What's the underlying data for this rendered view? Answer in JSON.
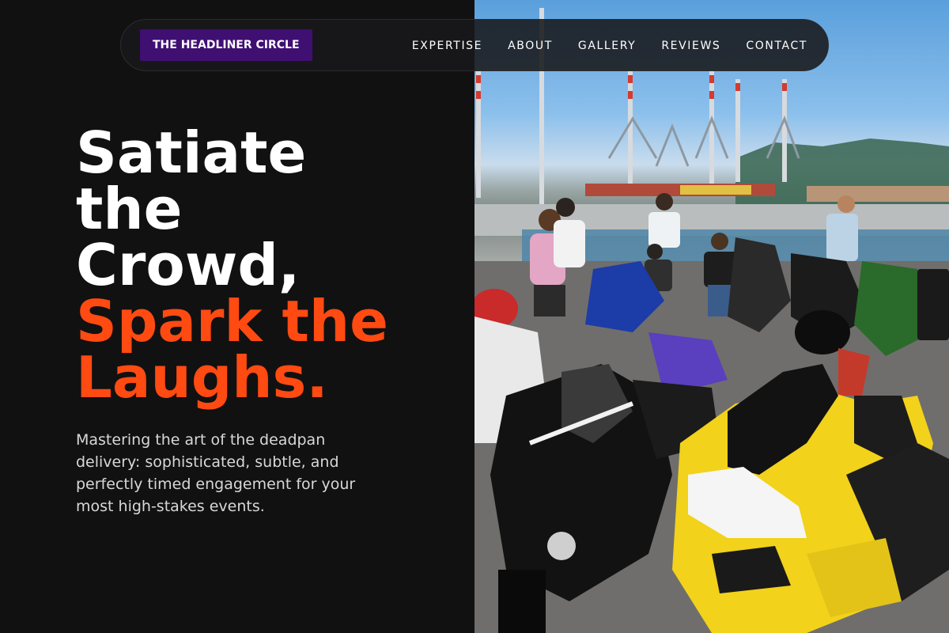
{
  "brand": {
    "label": "THE HEADLINER CIRCLE"
  },
  "nav": {
    "items": [
      "EXPERTISE",
      "ABOUT",
      "GALLERY",
      "REVIEWS",
      "CONTACT"
    ]
  },
  "hero": {
    "headline_lines": [
      "Satiate",
      "the",
      "Crowd,"
    ],
    "accent_lines": [
      "Spark the",
      "Laughs."
    ],
    "subcopy": "Mastering the art of the deadpan delivery: sophisticated, subtle, and perfectly timed engagement for your most high-stakes events."
  },
  "colors": {
    "background": "#111111",
    "brand_bg": "#3f0f72",
    "accent": "#ff4a12",
    "nav_text": "#ffffff"
  }
}
